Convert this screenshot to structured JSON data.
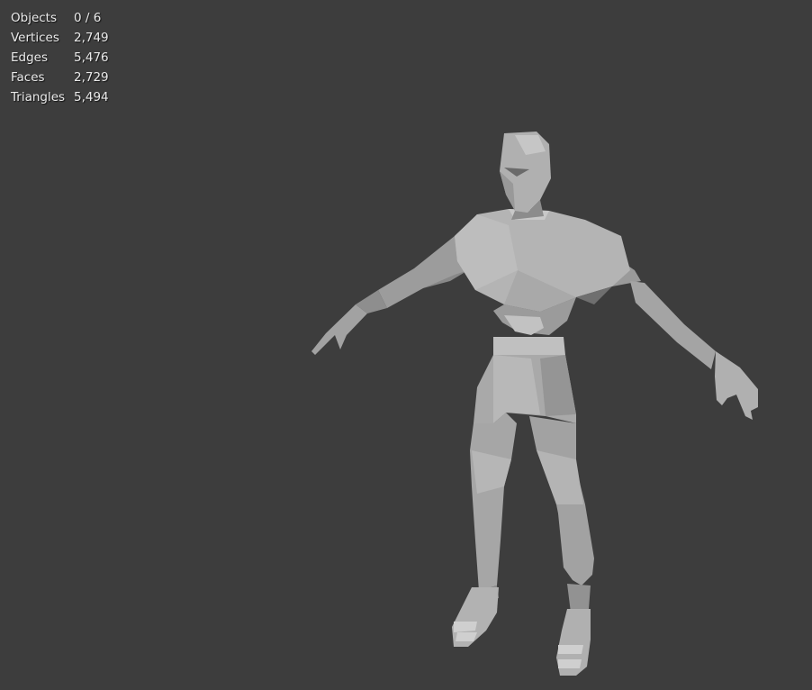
{
  "viewport": {
    "background": "#3d3d3d",
    "model_color": "#a8a8a8",
    "content": "low-poly humanoid character mesh in T-pose"
  },
  "stats": [
    {
      "label": "Objects",
      "value": "0 / 6"
    },
    {
      "label": "Vertices",
      "value": "2,749"
    },
    {
      "label": "Edges",
      "value": "5,476"
    },
    {
      "label": "Faces",
      "value": "2,729"
    },
    {
      "label": "Triangles",
      "value": "5,494"
    }
  ]
}
